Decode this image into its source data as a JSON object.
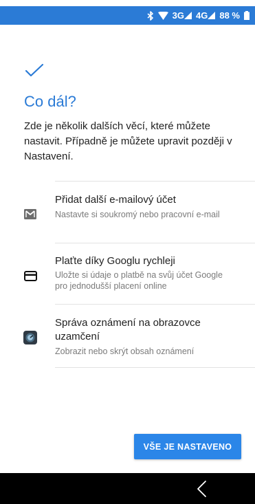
{
  "status_bar": {
    "bluetooth_icon": "bluetooth-icon",
    "wifi_icon": "wifi-icon",
    "network_3g": "3G",
    "network_4g": "4G",
    "battery_percent": "88 %",
    "battery_level": 0.88,
    "background_color": "#2b7bd6"
  },
  "main": {
    "check_icon": "checkmark-icon",
    "heading": "Co dál?",
    "intro_text": "Zde je několik dalších věcí, které můžete nastavit. Případně je můžete upravit později v Nastavení.",
    "accent_color": "#2b7bd6"
  },
  "options": [
    {
      "icon": "email-icon",
      "title": "Přidat další e-mailový účet",
      "subtitle": "Nastavte si soukromý nebo pracovní e-mail"
    },
    {
      "icon": "credit-card-icon",
      "title": "Plaťte díky Googlu rychleji",
      "subtitle": "Uložte si údaje o platbě na svůj účet Google pro jednodušší placení online"
    },
    {
      "icon": "lockscreen-notification-icon",
      "title": "Správa oznámení na obrazovce uzamčení",
      "subtitle": "Zobrazit nebo skrýt obsah oznámení"
    }
  ],
  "footer": {
    "done_button_label": "VŠE JE NASTAVENO",
    "button_color": "#2b86e8"
  },
  "nav_bar": {
    "back_icon": "back-icon"
  }
}
